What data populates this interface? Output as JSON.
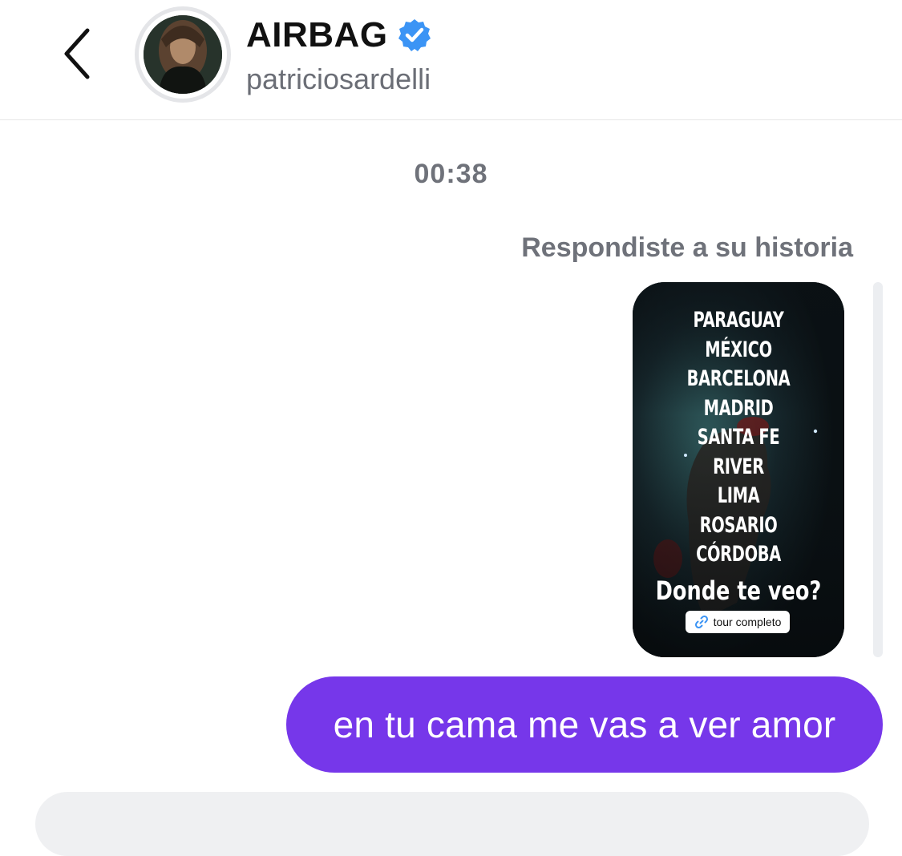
{
  "header": {
    "back_icon": "chevron-left-icon",
    "display_name": "AIRBAG",
    "verified_icon": "verified-badge-icon",
    "username": "patriciosardelli"
  },
  "conversation": {
    "timestamp": "00:38",
    "reply_note": "Respondiste a su historia",
    "story": {
      "cities": [
        "PARAGUAY",
        "MÉXICO",
        "BARCELONA",
        "MADRID",
        "SANTA FE",
        "RIVER",
        "LIMA",
        "ROSARIO",
        "CÓRDOBA"
      ],
      "question": "Donde te veo?",
      "link_label": "tour completo",
      "link_icon": "link-icon"
    },
    "message": "en tu cama me vas a ver amor"
  },
  "colors": {
    "bubble": "#7637ea",
    "verified": "#3b94f5",
    "meta_text": "#6f727a"
  }
}
